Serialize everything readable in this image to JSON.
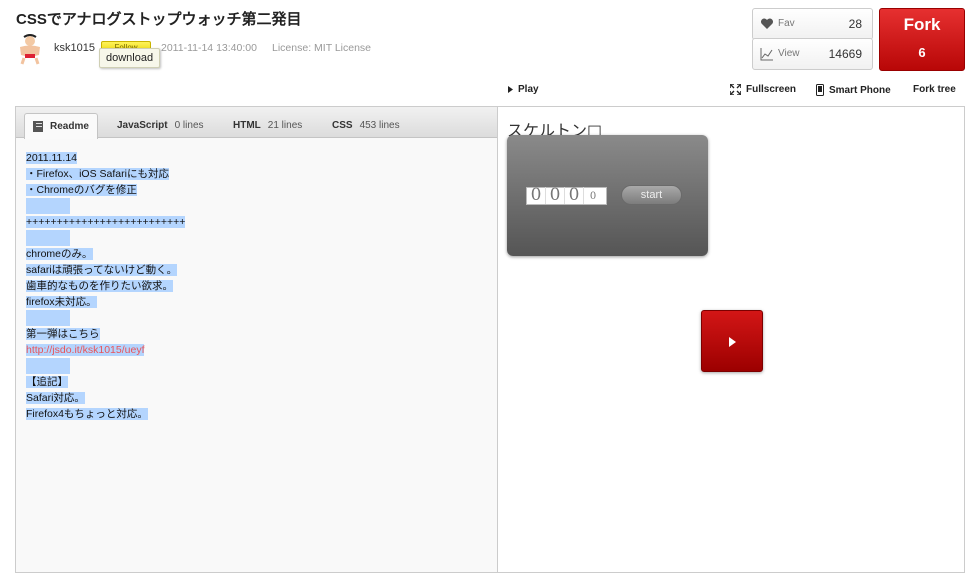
{
  "header": {
    "title": "CSSでアナログストップウォッチ第二発目",
    "username": "ksk1015",
    "follow_label": "Follow",
    "tooltip": "download",
    "date": "2011-11-14 13:40:00",
    "license": "License: MIT License"
  },
  "stats": {
    "fav_label": "Fav",
    "fav_count": "28",
    "view_label": "View",
    "view_count": "14669",
    "fork_label": "Fork",
    "fork_count": "6"
  },
  "toolbar": {
    "play": "Play",
    "fullscreen": "Fullscreen",
    "smartphone": "Smart Phone",
    "forktree": "Fork tree"
  },
  "tabs": [
    {
      "label": "Readme",
      "lines": ""
    },
    {
      "label": "JavaScript",
      "lines": "0 lines"
    },
    {
      "label": "HTML",
      "lines": "21 lines"
    },
    {
      "label": "CSS",
      "lines": "453 lines"
    }
  ],
  "readme": {
    "lines": [
      "2011.11.14",
      "・Firefox、iOS Safariにも対応",
      "・Chromeのバグを修正",
      "",
      "++++++++++++++++++++++++++",
      "",
      "chromeのみ。",
      "safariは頑張ってないけど動く。",
      "歯車的なものを作りたい欲求。",
      "firefox未対応。",
      "",
      "第一弾はこちら",
      "http://jsdo.it/ksk1015/ueyf",
      "",
      "【追記】",
      "Safari対応。",
      "Firefox4もちょっと対応。"
    ]
  },
  "demo": {
    "title": "スケルトン□",
    "digits": [
      "0",
      "0",
      "0",
      "0"
    ],
    "start_label": "start"
  },
  "colors": {
    "accent_red": "#c40d0d",
    "selection": "#b4d5fe",
    "link": "#e8545a",
    "follow_yellow": "#f4e21a"
  }
}
